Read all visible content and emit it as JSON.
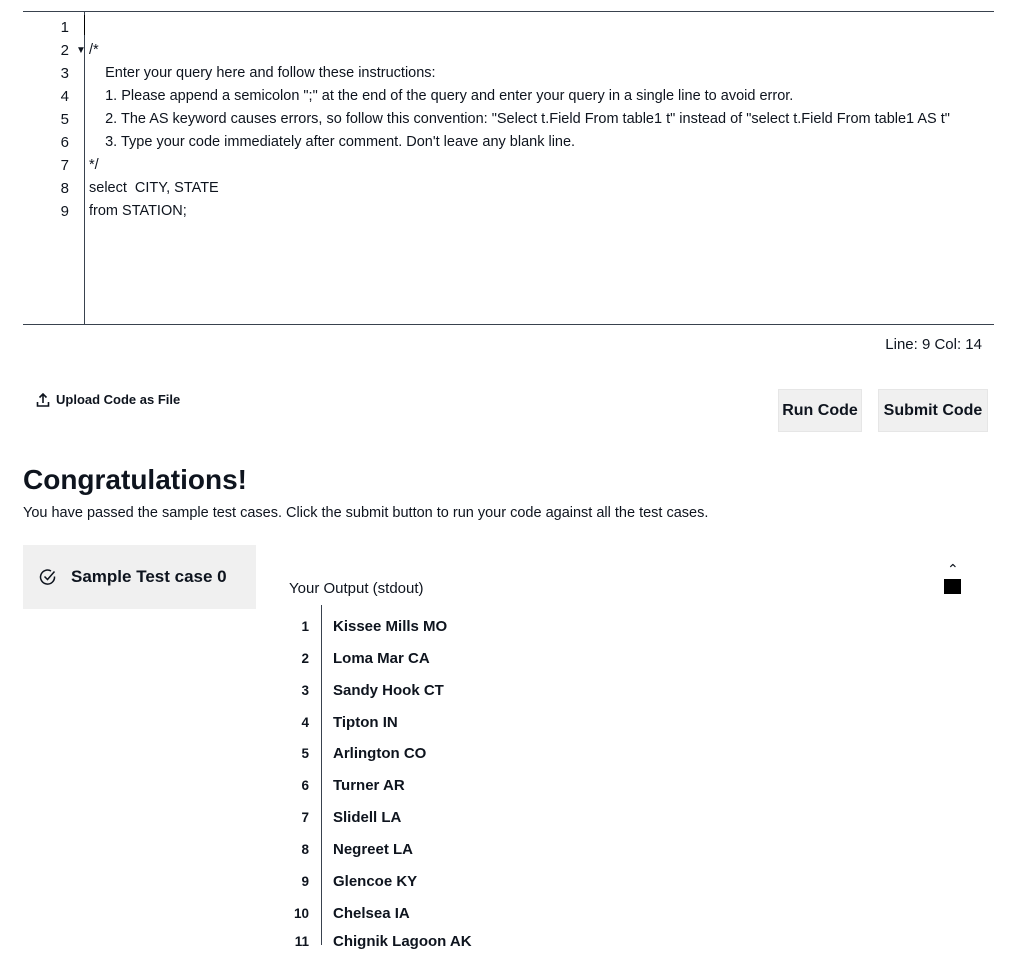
{
  "editor": {
    "line_numbers": [
      "1",
      "2",
      "3",
      "4",
      "5",
      "6",
      "7",
      "8",
      "9"
    ],
    "fold_marker": "▼",
    "lines": [
      "",
      "/*",
      "    Enter your query here and follow these instructions:",
      "    1. Please append a semicolon \";\" at the end of the query and enter your query in a single line to avoid error.",
      "    2. The AS keyword causes errors, so follow this convention: \"Select t.Field From table1 t\" instead of \"select t.Field From table1 AS t\"",
      "    3. Type your code immediately after comment. Don't leave any blank line.",
      "*/",
      "select  CITY, STATE",
      "from STATION;"
    ],
    "status": "Line: 9 Col: 14"
  },
  "toolbar": {
    "upload_label": "Upload Code as File",
    "run_label": "Run Code",
    "submit_label": "Submit Code"
  },
  "result": {
    "title": "Congratulations!",
    "message": "You have passed the sample test cases. Click the submit button to run your code against all the test cases.",
    "testcase_label": "Sample Test case 0",
    "output_label": "Your Output (stdout)",
    "collapse_icon": "chevron-up-icon",
    "output_rows": [
      {
        "n": "1",
        "v": "Kissee Mills MO"
      },
      {
        "n": "2",
        "v": "Loma Mar CA"
      },
      {
        "n": "3",
        "v": "Sandy Hook CT"
      },
      {
        "n": "4",
        "v": "Tipton IN"
      },
      {
        "n": "5",
        "v": "Arlington CO"
      },
      {
        "n": "6",
        "v": "Turner AR"
      },
      {
        "n": "7",
        "v": "Slidell LA"
      },
      {
        "n": "8",
        "v": "Negreet LA"
      },
      {
        "n": "9",
        "v": "Glencoe KY"
      },
      {
        "n": "10",
        "v": "Chelsea IA"
      },
      {
        "n": "11",
        "v": "Chignik Lagoon AK"
      }
    ]
  }
}
